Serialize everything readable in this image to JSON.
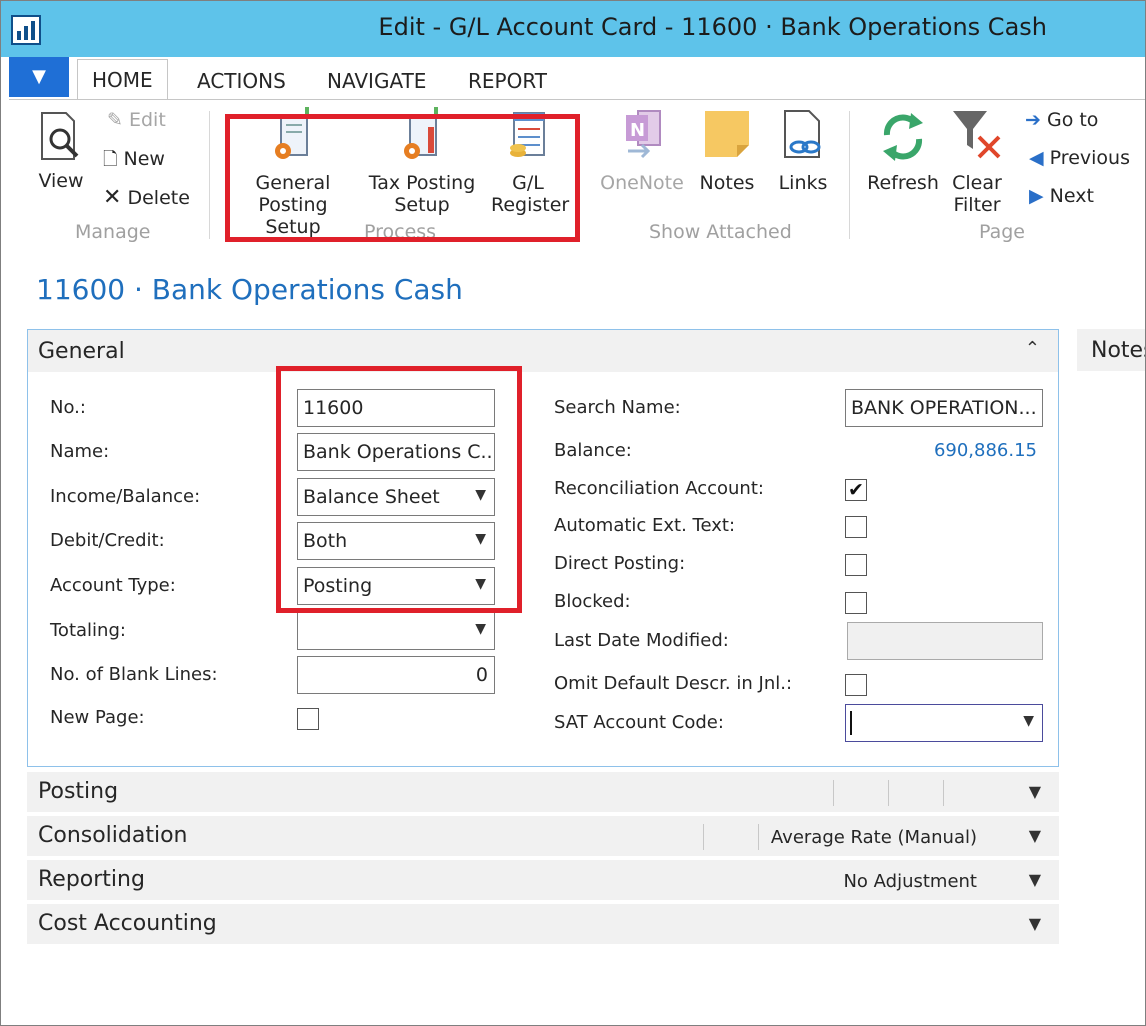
{
  "window": {
    "title": "Edit - G/L Account Card - 11600 · Bank Operations Cash"
  },
  "tabs": [
    "HOME",
    "ACTIONS",
    "NAVIGATE",
    "REPORT"
  ],
  "ribbon": {
    "manage": {
      "group_label": "Manage",
      "view": "View",
      "edit": "Edit",
      "new": "New",
      "delete": "Delete"
    },
    "process": {
      "group_label": "Process",
      "general_posting_setup": [
        "General",
        "Posting Setup"
      ],
      "tax_posting_setup": [
        "Tax Posting",
        "Setup"
      ],
      "gl_register": [
        "G/L",
        "Register"
      ]
    },
    "show_attached": {
      "group_label": "Show Attached",
      "onenote": "OneNote",
      "notes": "Notes",
      "links": "Links"
    },
    "page": {
      "group_label": "Page",
      "refresh": "Refresh",
      "clear_filter": [
        "Clear",
        "Filter"
      ],
      "go_to": "Go to",
      "previous": "Previous",
      "next": "Next"
    }
  },
  "page_title": "11600 · Bank Operations Cash",
  "general": {
    "title": "General",
    "left": {
      "no_label": "No.:",
      "no_value": "11600",
      "name_label": "Name:",
      "name_value": "Bank Operations C...",
      "income_balance_label": "Income/Balance:",
      "income_balance_value": "Balance Sheet",
      "debit_credit_label": "Debit/Credit:",
      "debit_credit_value": "Both",
      "account_type_label": "Account Type:",
      "account_type_value": "Posting",
      "totaling_label": "Totaling:",
      "totaling_value": "",
      "blank_lines_label": "No. of Blank Lines:",
      "blank_lines_value": "0",
      "new_page_label": "New Page:",
      "new_page_checked": false
    },
    "right": {
      "search_name_label": "Search Name:",
      "search_name_value": "BANK OPERATION...",
      "balance_label": "Balance:",
      "balance_value": "690,886.15",
      "reconciliation_label": "Reconciliation Account:",
      "reconciliation_checked": true,
      "auto_ext_text_label": "Automatic Ext. Text:",
      "auto_ext_text_checked": false,
      "direct_posting_label": "Direct Posting:",
      "direct_posting_checked": false,
      "blocked_label": "Blocked:",
      "blocked_checked": false,
      "last_date_label": "Last Date Modified:",
      "last_date_value": "",
      "omit_descr_label": "Omit Default Descr. in Jnl.:",
      "omit_descr_checked": false,
      "sat_code_label": "SAT Account Code:",
      "sat_code_value": ""
    }
  },
  "sections": {
    "posting": "Posting",
    "consolidation": "Consolidation",
    "consolidation_value": "Average Rate (Manual)",
    "reporting": "Reporting",
    "reporting_value": "No Adjustment",
    "cost_accounting": "Cost Accounting"
  },
  "factbox": {
    "notes": "Notes"
  },
  "glyphs": {
    "check": "✔",
    "chev_down": "❯",
    "caret": "⌃"
  },
  "colors": {
    "titlebar": "#5ec3ea",
    "accent": "#1f6fbd",
    "highlight": "#e0202a"
  }
}
